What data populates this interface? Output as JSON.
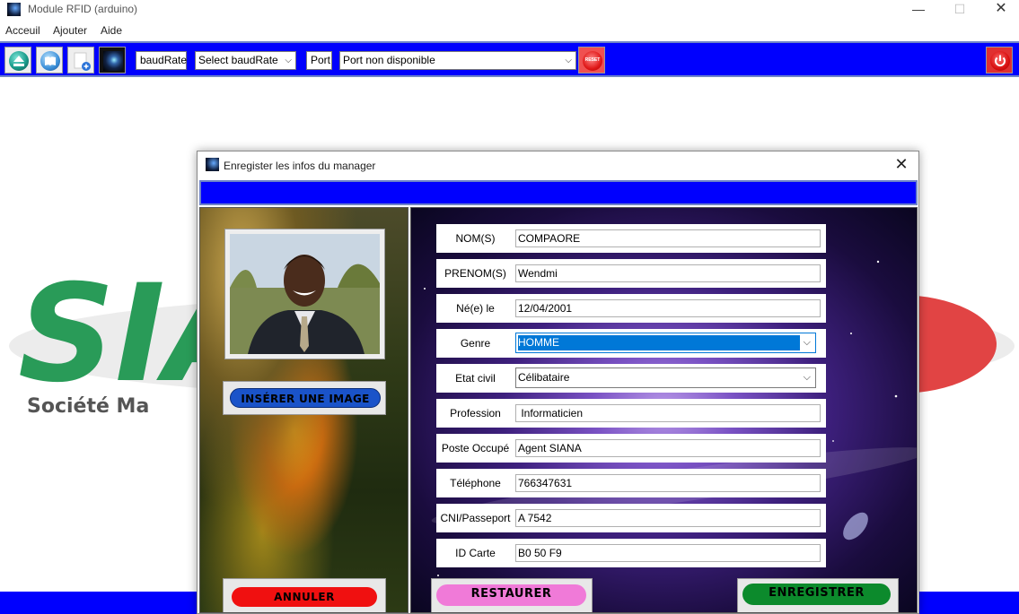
{
  "window": {
    "title": "Module RFID  (arduino)",
    "min": "—",
    "max": "☐",
    "close": "✕"
  },
  "menu": [
    "Acceuil",
    "Ajouter",
    "Aide"
  ],
  "toolbar": {
    "baud_label": "baudRate",
    "baud_select": "Select baudRate",
    "port_label": "Port",
    "port_select": "Port non disponible",
    "reset_text": "RESET",
    "chevron": "⌵"
  },
  "background": {
    "logo_text": "SIANA",
    "logo_subtitle": "Société Ma                                                                        esse"
  },
  "dialog": {
    "title": "Enregister les infos du manager",
    "close": "✕",
    "insert_image_label": "INSÉRER UNE IMAGE",
    "cancel_label": "ANNULER",
    "reset_label": "RESTAURER",
    "save_label": "ENREGISTRER",
    "fields": {
      "nom": {
        "label": "NOM(S)",
        "value": "COMPAORE"
      },
      "prenom": {
        "label": "PRENOM(S)",
        "value": "Wendmi"
      },
      "naissance": {
        "label": "Né(e) le",
        "value": "12/04/2001"
      },
      "genre": {
        "label": "Genre",
        "value": "HOMME"
      },
      "etat_civil": {
        "label": "Etat civil",
        "value": "Célibataire"
      },
      "profession": {
        "label": "Profession",
        "value": " Informaticien"
      },
      "poste": {
        "label": "Poste Occupé",
        "value": "Agent SIANA"
      },
      "telephone": {
        "label": "Téléphone",
        "value": "766347631"
      },
      "cni": {
        "label": "CNI/Passeport",
        "value": "A 7542"
      },
      "id_carte": {
        "label": "ID Carte",
        "value": "B0 50 F9"
      }
    },
    "colors": {
      "accent_blue": "#0000fe",
      "cancel": "#f01010",
      "reset": "#f07ad8",
      "save": "#0c8a2c",
      "insert": "#1a53c9"
    }
  }
}
